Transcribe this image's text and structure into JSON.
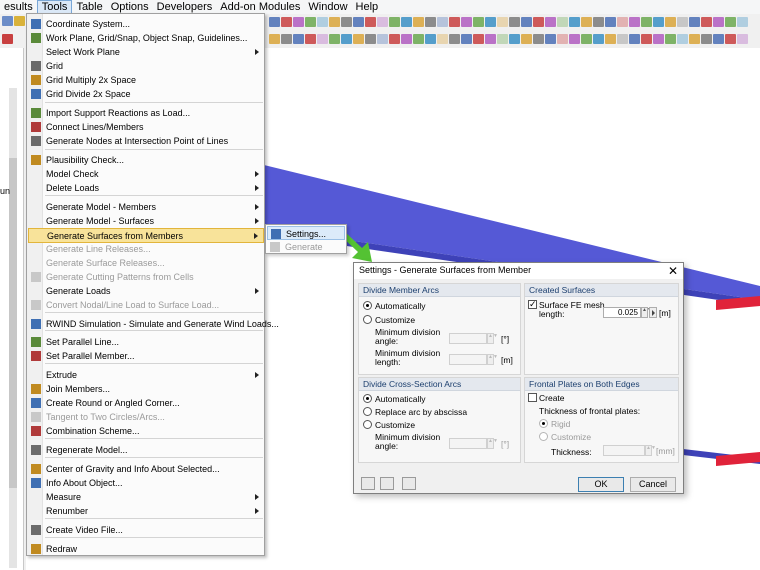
{
  "menubar": {
    "items": [
      "esults",
      "Tools",
      "Table",
      "Options",
      "Developers",
      "Add-on Modules",
      "Window",
      "Help"
    ]
  },
  "left_panel": {
    "fragment": "un"
  },
  "tools_menu": {
    "items": [
      {
        "label": "Coordinate System...",
        "icon": "coordinate-icon"
      },
      {
        "label": "Work Plane, Grid/Snap, Object Snap, Guidelines...",
        "icon": "workplane-icon"
      },
      {
        "label": "Select Work Plane",
        "submenu": true
      },
      {
        "label": "Grid",
        "icon": "grid-icon"
      },
      {
        "label": "Grid Multiply 2x Space",
        "icon": "grid-multiply-icon"
      },
      {
        "label": "Grid Divide 2x Space",
        "icon": "grid-divide-icon"
      },
      {
        "label": "Import Support Reactions as Load...",
        "icon": "import-reactions-icon"
      },
      {
        "label": "Connect Lines/Members",
        "icon": "connect-lines-icon"
      },
      {
        "label": "Generate Nodes at Intersection Point of Lines",
        "icon": "intersection-nodes-icon"
      },
      {
        "label": "Plausibility Check...",
        "icon": "plausibility-icon"
      },
      {
        "label": "Model Check",
        "submenu": true
      },
      {
        "label": "Delete Loads",
        "submenu": true
      },
      {
        "label": "Generate Model - Members",
        "submenu": true
      },
      {
        "label": "Generate Model - Surfaces",
        "submenu": true
      },
      {
        "label": "Generate Surfaces from Members",
        "submenu": true,
        "highlighted": true
      },
      {
        "label": "Generate Line Releases...",
        "disabled": true
      },
      {
        "label": "Generate Surface Releases...",
        "disabled": true
      },
      {
        "label": "Generate Cutting Patterns from Cells",
        "disabled": true,
        "icon": "cutting-pattern-icon"
      },
      {
        "label": "Generate Loads",
        "submenu": true
      },
      {
        "label": "Convert Nodal/Line Load to Surface Load...",
        "disabled": true,
        "icon": "convert-load-icon"
      },
      {
        "label": "RWIND Simulation - Simulate and Generate Wind Loads...",
        "icon": "rwind-icon"
      },
      {
        "label": "Set Parallel Line...",
        "icon": "parallel-line-icon"
      },
      {
        "label": "Set Parallel Member...",
        "icon": "parallel-member-icon"
      },
      {
        "label": "Extrude",
        "submenu": true
      },
      {
        "label": "Join Members...",
        "icon": "join-members-icon"
      },
      {
        "label": "Create Round or Angled Corner...",
        "icon": "round-corner-icon"
      },
      {
        "label": "Tangent to Two Circles/Arcs...",
        "disabled": true,
        "icon": "tangent-icon"
      },
      {
        "label": "Combination Scheme...",
        "icon": "combination-icon"
      },
      {
        "label": "Regenerate Model...",
        "icon": "regenerate-icon"
      },
      {
        "label": "Center of Gravity and Info About Selected...",
        "icon": "center-gravity-icon"
      },
      {
        "label": "Info About Object...",
        "icon": "info-object-icon"
      },
      {
        "label": "Measure",
        "submenu": true
      },
      {
        "label": "Renumber",
        "submenu": true
      },
      {
        "label": "Create Video File...",
        "icon": "video-icon"
      },
      {
        "label": "Redraw",
        "icon": "redraw-icon"
      }
    ]
  },
  "submenu": {
    "items": [
      {
        "label": "Settings...",
        "highlighted": true,
        "icon": "settings-icon"
      },
      {
        "label": "Generate",
        "disabled": true,
        "icon": "generate-icon"
      }
    ]
  },
  "dialog": {
    "title": "Settings - Generate Surfaces from Member",
    "close": "✕",
    "divide_member_arcs": {
      "header": "Divide Member Arcs",
      "automatically": "Automatically",
      "customize": "Customize",
      "min_angle_label_1": "Minimum division",
      "min_angle_label_2": "angle:",
      "min_angle_unit": "[°]",
      "min_length_label_1": "Minimum division",
      "min_length_label_2": "length:",
      "min_length_unit": "[m]"
    },
    "created_surfaces": {
      "header": "Created Surfaces",
      "fe_mesh_label_1": "Surface FE mesh",
      "fe_mesh_label_2": "length:",
      "fe_mesh_value": "0.025",
      "fe_mesh_unit": "[m]"
    },
    "divide_cross_section_arcs": {
      "header": "Divide Cross-Section Arcs",
      "automatically": "Automatically",
      "replace_arc": "Replace arc by abscissa",
      "customize": "Customize",
      "min_angle_label_1": "Minimum division",
      "min_angle_label_2": "angle:",
      "min_angle_unit": "[°]"
    },
    "frontal_plates": {
      "header": "Frontal Plates on Both Edges",
      "create": "Create",
      "thickness_of": "Thickness of frontal plates:",
      "rigid": "Rigid",
      "customize": "Customize",
      "thickness": "Thickness:",
      "thickness_unit": "[mm]"
    },
    "ok": "OK",
    "cancel": "Cancel"
  },
  "colors": {
    "beam_blue": "#5559d6",
    "beam_red": "#e0233a",
    "arrow_green": "#54c233",
    "menu_highlight": "#f8e39a"
  }
}
